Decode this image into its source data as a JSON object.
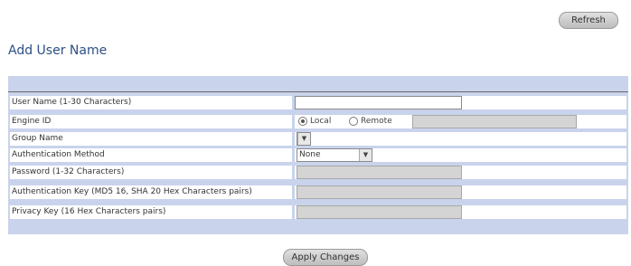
{
  "toolbar": {
    "refresh_label": "Refresh"
  },
  "page": {
    "title": "Add User Name"
  },
  "form": {
    "user_name": {
      "label": "User Name (1-30 Characters)",
      "value": ""
    },
    "engine_id": {
      "label": "Engine ID",
      "local_label": "Local",
      "remote_label": "Remote",
      "selected": "Local",
      "remote_value": ""
    },
    "group_name": {
      "label": "Group Name",
      "value": ""
    },
    "auth_method": {
      "label": "Authentication Method",
      "value": "None"
    },
    "password": {
      "label": "Password (1-32 Characters)",
      "value": ""
    },
    "auth_key": {
      "label": "Authentication Key (MD5 16, SHA 20 Hex Characters pairs)",
      "value": ""
    },
    "privacy_key": {
      "label": "Privacy Key (16 Hex Characters pairs)",
      "value": ""
    }
  },
  "actions": {
    "apply_label": "Apply Changes"
  }
}
